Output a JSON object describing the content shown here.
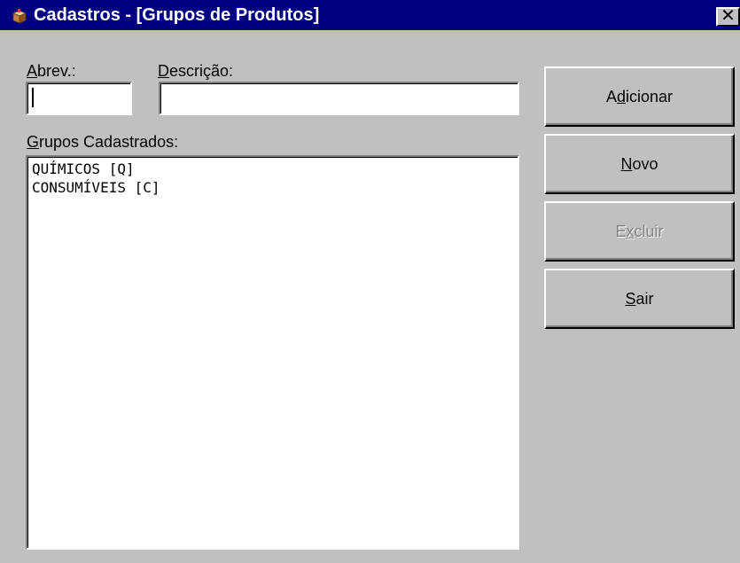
{
  "window": {
    "title": "Cadastros - [Grupos de Produtos]",
    "close_glyph": "✕",
    "colors": {
      "titlebar": "#000080",
      "face": "#c0c0c0",
      "disabled_text": "#808080"
    }
  },
  "form": {
    "abrev": {
      "label_u": "A",
      "label_rest": "brev.:",
      "value": ""
    },
    "descricao": {
      "label_u": "D",
      "label_rest": "escrição:",
      "value": ""
    },
    "grupos": {
      "label_u": "G",
      "label_rest": "rupos Cadastrados:"
    }
  },
  "list": {
    "items": [
      "QUÍMICOS [Q]",
      "CONSUMÍVEIS [C]"
    ]
  },
  "buttons": {
    "adicionar": {
      "pre": "A",
      "u": "d",
      "post": "icionar",
      "enabled": true
    },
    "novo": {
      "pre": "",
      "u": "N",
      "post": "ovo",
      "enabled": true
    },
    "excluir": {
      "pre": "E",
      "u": "x",
      "post": "cluir",
      "enabled": false
    },
    "sair": {
      "pre": "",
      "u": "S",
      "post": "air",
      "enabled": true
    }
  },
  "icons": {
    "app": "package-icon",
    "close": "close-icon"
  }
}
